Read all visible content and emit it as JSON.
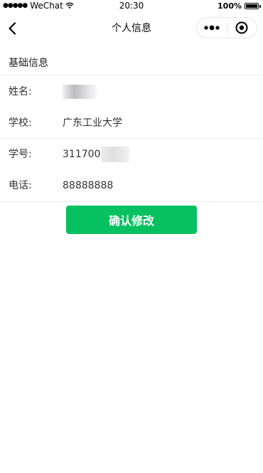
{
  "status_bar": {
    "signal_dots": "●●●●●",
    "carrier": "WeChat",
    "time": "20:30",
    "battery": "100%",
    "battery_level": 1.0
  },
  "nav": {
    "title": "个人信息",
    "back_icon": "chevron-left-icon",
    "more_icon": "more-dots-icon",
    "close_icon": "target-circle-icon"
  },
  "section": {
    "title": "基础信息"
  },
  "fields": {
    "name": {
      "label": "姓名:",
      "value": ""
    },
    "school": {
      "label": "学校:",
      "value": "广东工业大学"
    },
    "student_id": {
      "label": "学号:",
      "value": "311700"
    },
    "phone": {
      "label": "电话:",
      "value": "88888888"
    }
  },
  "confirm_button": {
    "label": "确认修改",
    "color": "#07c160"
  }
}
